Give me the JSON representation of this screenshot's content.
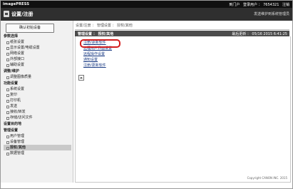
{
  "top": {
    "logo": "imagePRESS",
    "links": [
      "到门户",
      "登录用户 ： 7654321",
      "注销"
    ]
  },
  "header": {
    "title": "设置/注册",
    "mail_link": "发送维护到系统管理员"
  },
  "sidebar": {
    "status_button": "确认初始设备",
    "items": [
      {
        "label": "参数选择",
        "type": "section"
      },
      {
        "label": "纸张设置",
        "type": "sub"
      },
      {
        "label": "显示设置/电缆设置",
        "type": "sub"
      },
      {
        "label": "网络设置",
        "type": "sub"
      },
      {
        "label": "外部接口",
        "type": "sub"
      },
      {
        "label": "辅助设置",
        "type": "sub"
      },
      {
        "label": "调整/维护",
        "type": "section"
      },
      {
        "label": "调整图像质量",
        "type": "sub"
      },
      {
        "label": "功能设置",
        "type": "section"
      },
      {
        "label": "系统设置",
        "type": "sub"
      },
      {
        "label": "复印",
        "type": "sub"
      },
      {
        "label": "打印机",
        "type": "sub"
      },
      {
        "label": "发送",
        "type": "sub"
      },
      {
        "label": "接收/转发",
        "type": "sub"
      },
      {
        "label": "存储/访问文件",
        "type": "sub"
      },
      {
        "label": "设置目的地",
        "type": "section"
      },
      {
        "label": "管理设置",
        "type": "section"
      },
      {
        "label": "用户管理",
        "type": "sub"
      },
      {
        "label": "设备管理",
        "type": "sub"
      },
      {
        "label": "授权/其他",
        "type": "sub",
        "active": true
      },
      {
        "label": "数据管理",
        "type": "sub"
      }
    ]
  },
  "main": {
    "breadcrumb": "设置/注册 ： 管理设置 ： 授权/其他",
    "section_title": "管理设置 ： 授权/其他",
    "last_updated": "最后更新 ： 05/16 2015 6:41:25",
    "links": [
      "注册/更新软件",
      "远程用户界面设置",
      "远程操作设置",
      "通知设置",
      "注册/更新软件"
    ],
    "footer": "Copyright CANON INC. 2015"
  }
}
